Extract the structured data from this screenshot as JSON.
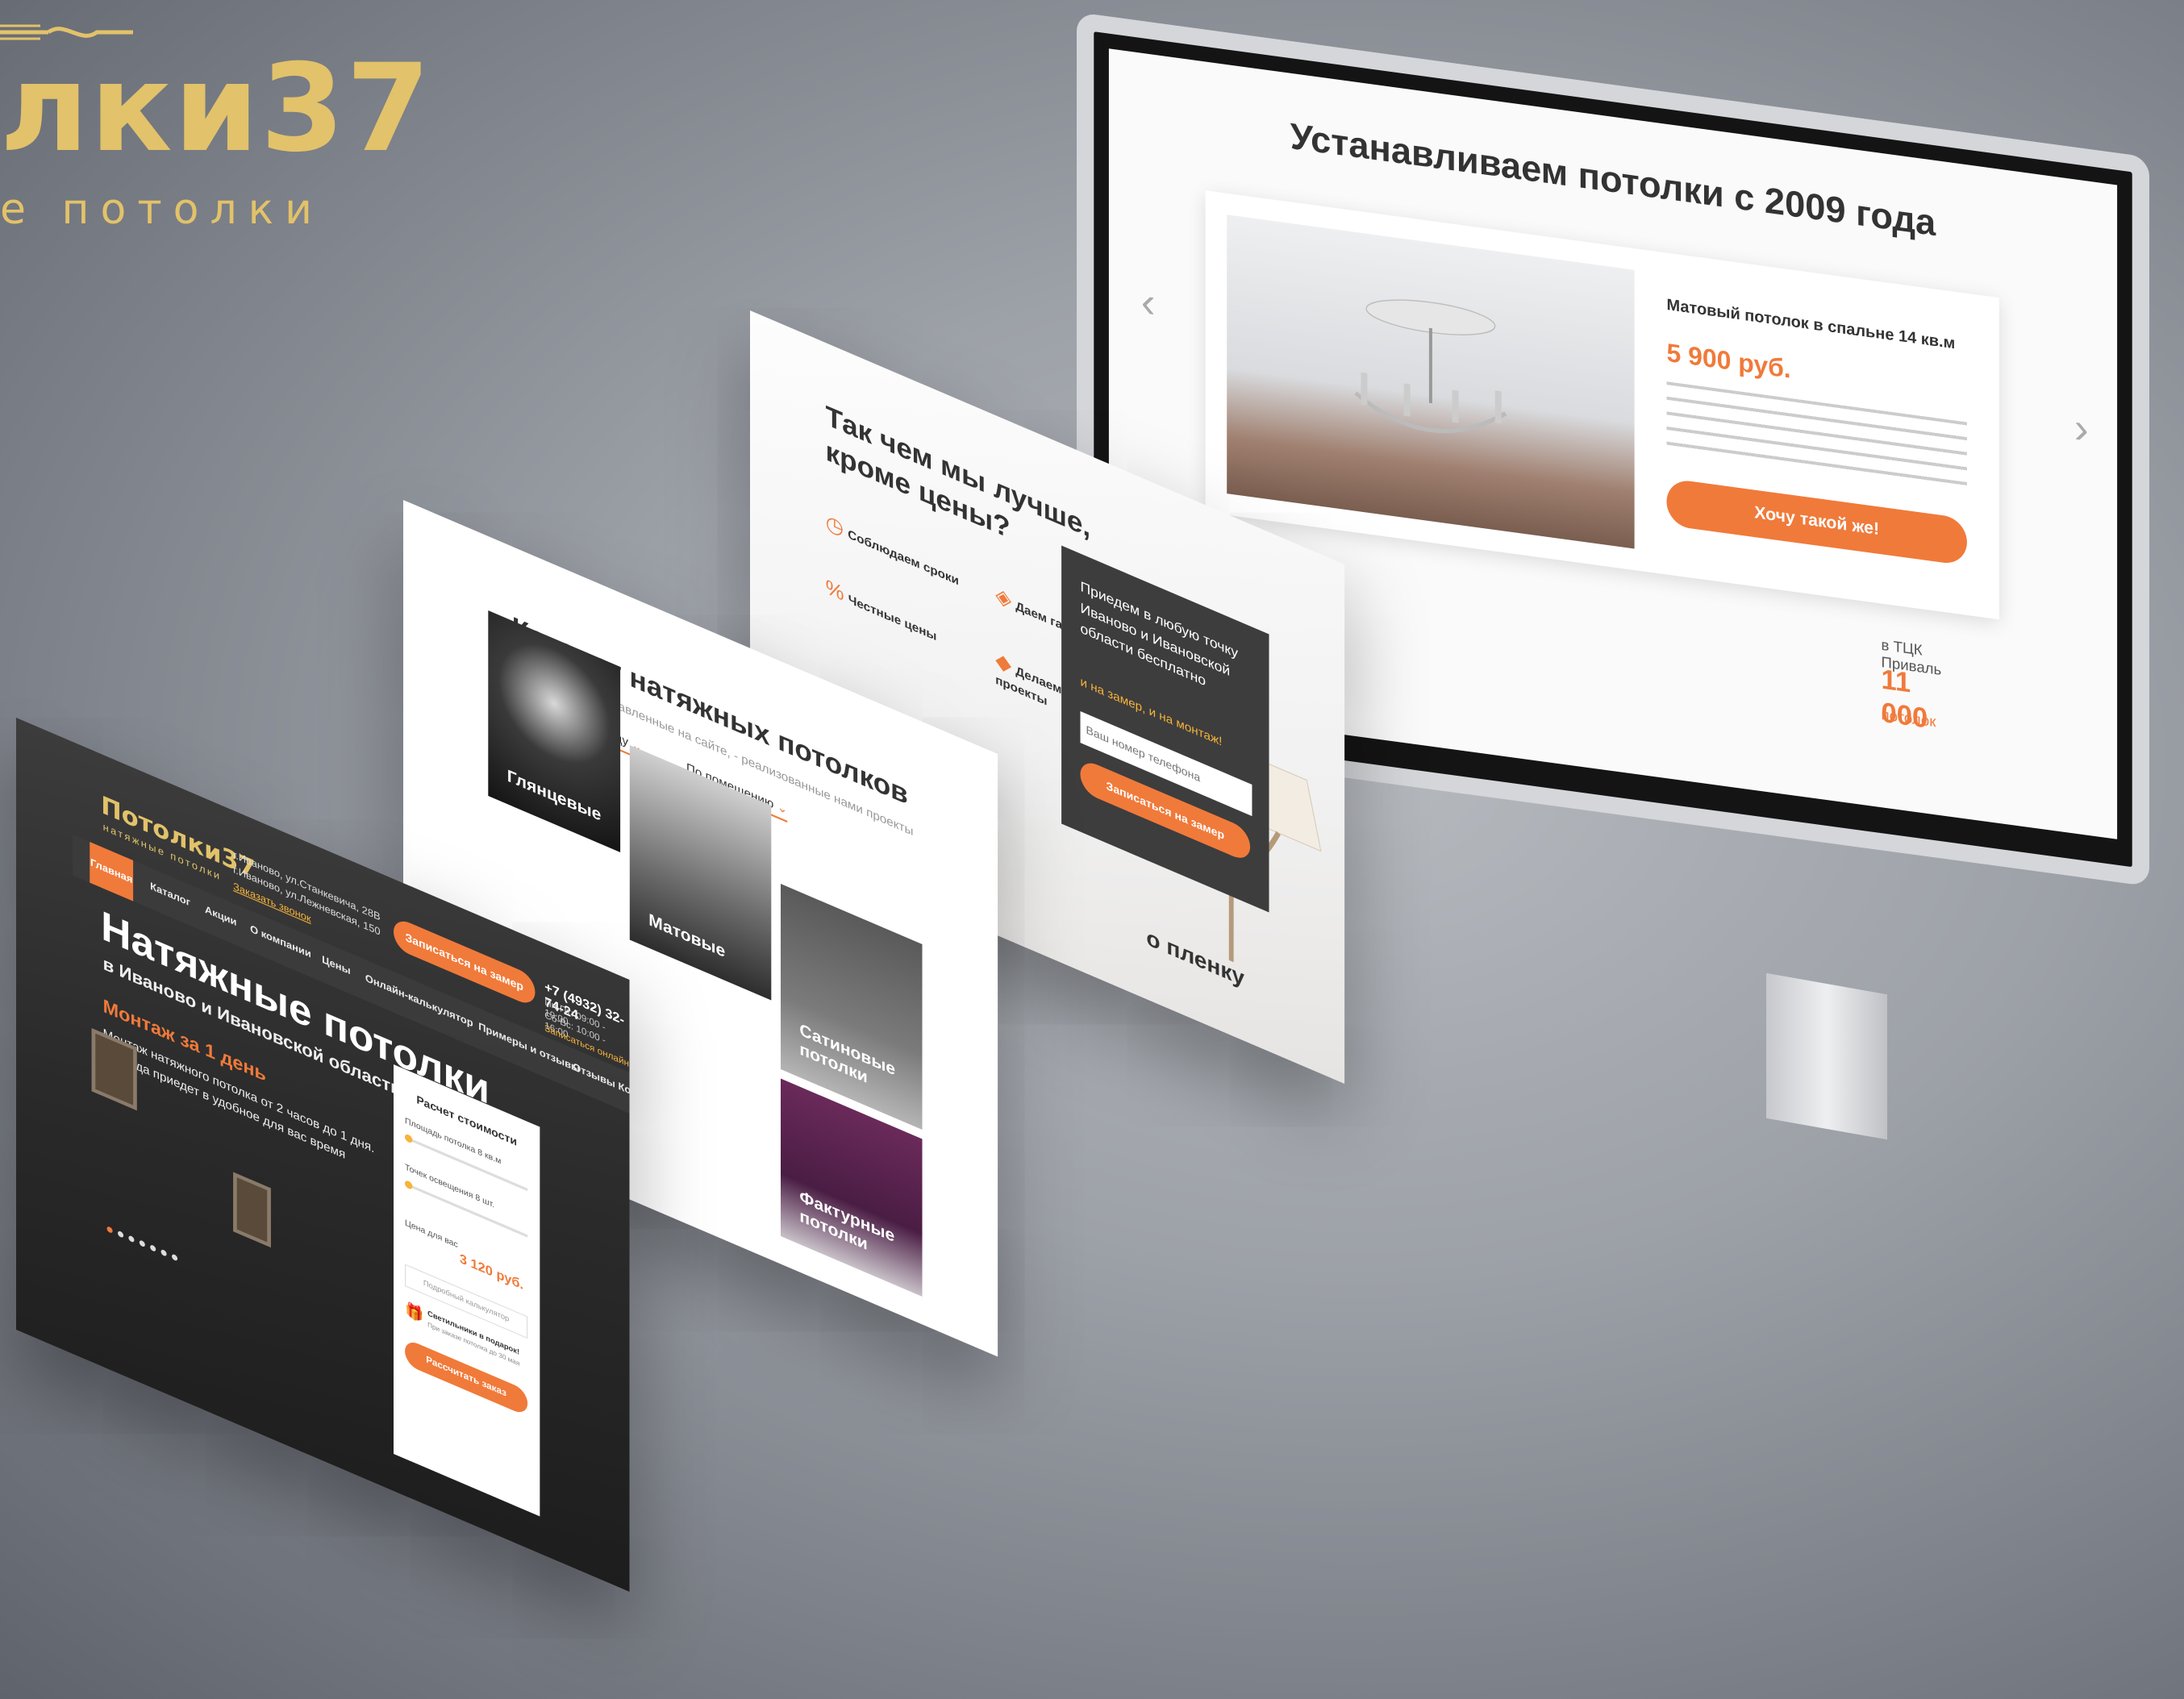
{
  "brand": {
    "logo_word": "лки37",
    "logo_sub": "е потолки"
  },
  "monitor": {
    "heading": "Устанавливаем потолки с 2009 года",
    "card_title": "Матовый потолок в спальне 14 кв.м",
    "card_price": "5 900 руб.",
    "card_button": "Хочу такой же!",
    "side_title": "в ТЦК Приваль",
    "side_price": "11 000",
    "side_unit": "потолок"
  },
  "page_why": {
    "heading": "Так чем мы лучше, кроме цены?",
    "items": [
      "Соблюдаем сроки",
      "Даем гарантию",
      "Честные цены",
      "Делаем сложные проекты"
    ],
    "popup_text": "Приедем в любую точку Иваново и Ивановской области бесплатно",
    "popup_accent": "бесплатно",
    "popup_note": "и на замер, и на монтаж!",
    "popup_placeholder": "Ваш номер телефона",
    "popup_button": "Записаться на замер",
    "footer_text": "о пленку"
  },
  "page_catalog": {
    "heading": "Каталог натяжных потолков",
    "subheading": "Все работы, представленные на сайте, - реализованные нами проекты",
    "filter_1": "По виду",
    "filter_2": "По помещению",
    "tiles": [
      "Глянцевые",
      "Матовые",
      "Сатиновые потолки",
      "Фактурные потолки"
    ]
  },
  "page_hero": {
    "logo": "Потолки37",
    "logo_sub": "натяжные потолки",
    "address_1": "г.Иваново, ул.Станкевича, 28В",
    "address_2": "г.Иваново, ул.Лежневская, 150",
    "callback": "Заказать звонок",
    "cta_top": "Записаться на замер",
    "phone": "+7 (4932) 32-74-24",
    "schedule_1": "Пн-Пт: 09:00 - 19:00",
    "schedule_2": "Сб-Вс: 10:00 - 16:00",
    "schedule_link": "Записаться онлайн",
    "nav": [
      "Главная",
      "Каталог",
      "Акции",
      "О компании",
      "Цены",
      "Онлайн-калькулятор",
      "Примеры и отзывы",
      "Отзывы",
      "Контакты"
    ],
    "title": "Натяжные потолки",
    "subtitle": "в Иваново и Ивановской области",
    "promo": "Монтаж за 1 день",
    "promo_text": "Монтаж натяжного потолка от 2 часов до 1 дня. Бригада приедет в удобное для вас время",
    "calc": {
      "title": "Расчет стоимости",
      "label_area": "Площадь потолка 8 кв.м",
      "label_points": "Точек освещения 8 шт.",
      "label_price": "Цена для вас",
      "price": "3 120 руб.",
      "input_placeholder": "Подробный калькулятор",
      "gift_title": "Светильники в подарок!",
      "gift_text": "При заказе потолка до 30 мая",
      "button": "Рассчитать заказ"
    }
  }
}
